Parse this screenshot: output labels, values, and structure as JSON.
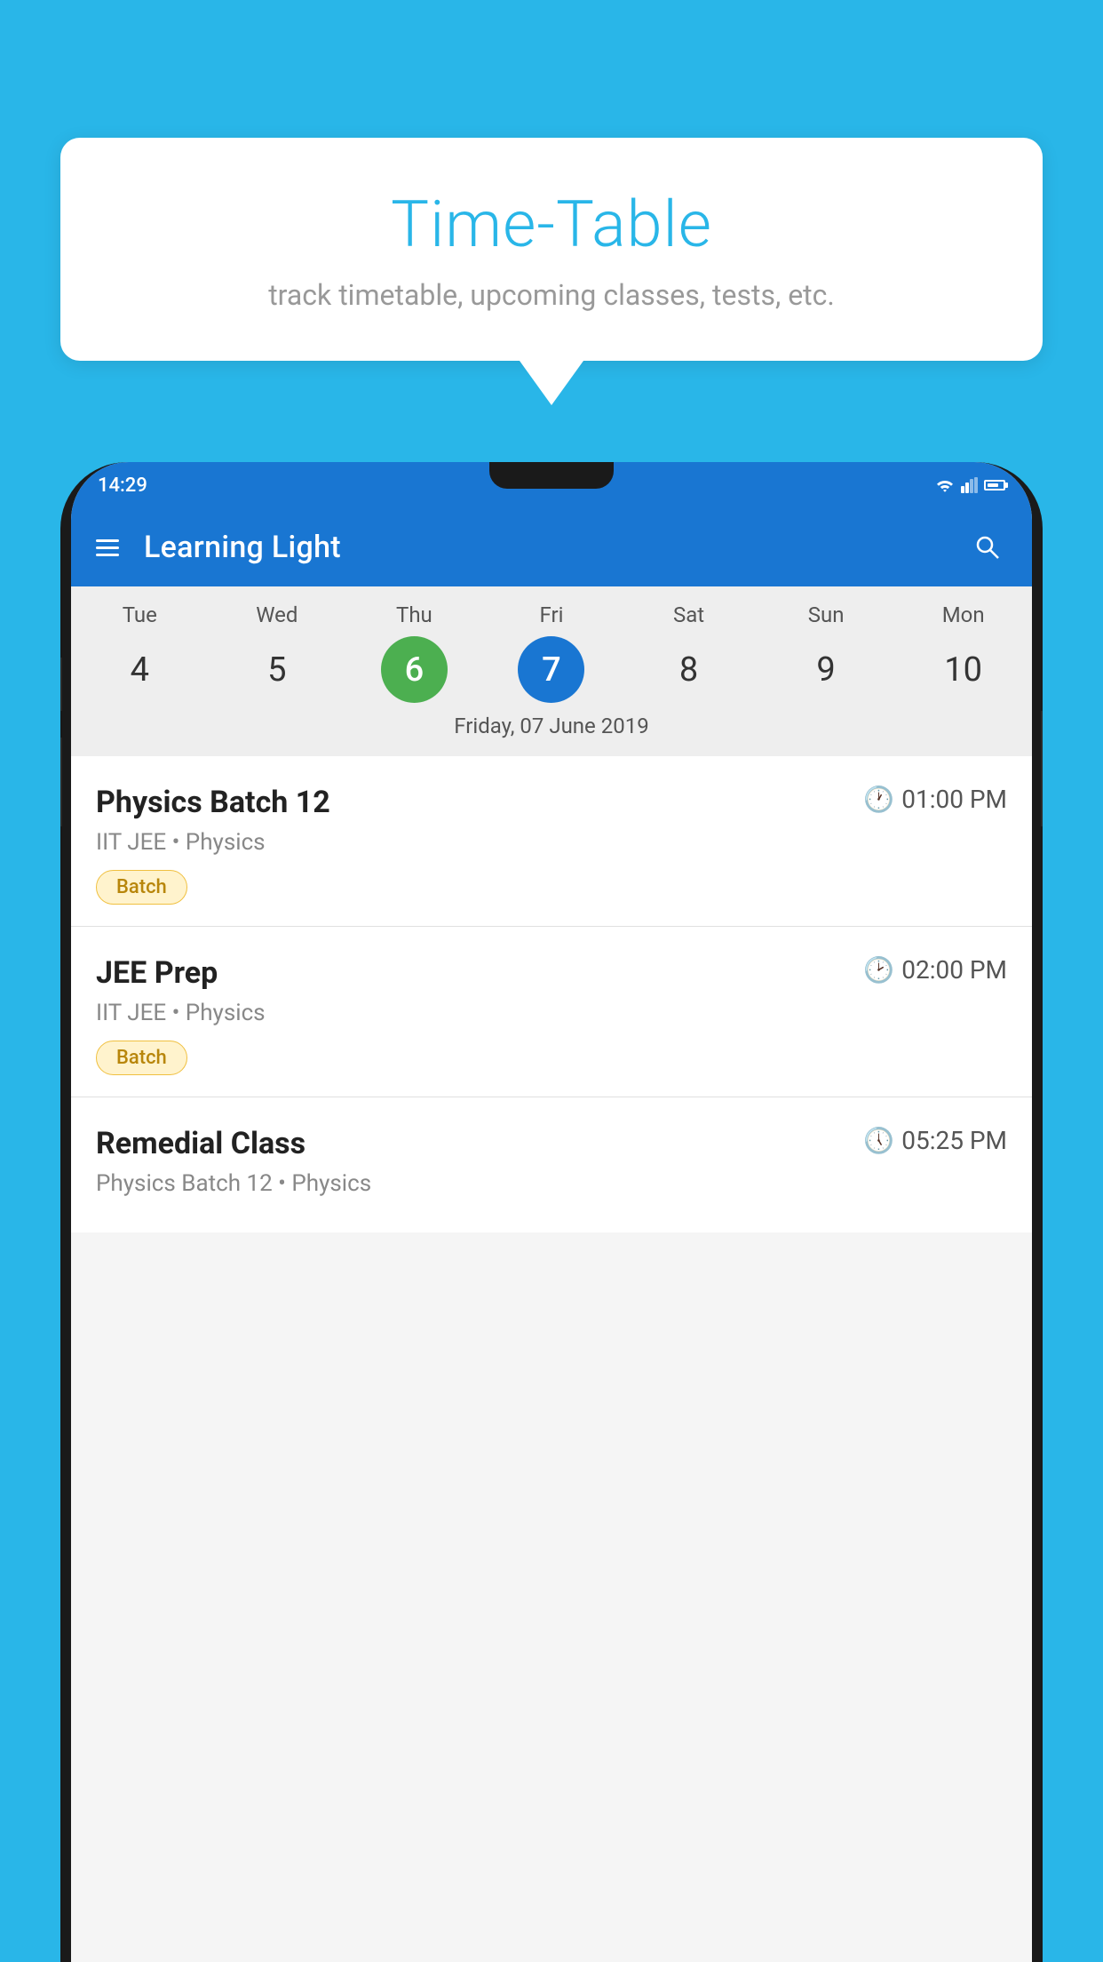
{
  "background_color": "#29b6e8",
  "speech_bubble": {
    "title": "Time-Table",
    "subtitle": "track timetable, upcoming classes, tests, etc."
  },
  "app_bar": {
    "title": "Learning Light",
    "hamburger_label": "menu",
    "search_label": "search"
  },
  "status_bar": {
    "time": "14:29"
  },
  "calendar": {
    "selected_date_label": "Friday, 07 June 2019",
    "days": [
      {
        "label": "Tue",
        "number": "4",
        "state": "normal"
      },
      {
        "label": "Wed",
        "number": "5",
        "state": "normal"
      },
      {
        "label": "Thu",
        "number": "6",
        "state": "today"
      },
      {
        "label": "Fri",
        "number": "7",
        "state": "selected"
      },
      {
        "label": "Sat",
        "number": "8",
        "state": "normal"
      },
      {
        "label": "Sun",
        "number": "9",
        "state": "normal"
      },
      {
        "label": "Mon",
        "number": "10",
        "state": "normal"
      }
    ]
  },
  "schedule": [
    {
      "title": "Physics Batch 12",
      "time": "01:00 PM",
      "subtitle": "IIT JEE • Physics",
      "badge": "Batch"
    },
    {
      "title": "JEE Prep",
      "time": "02:00 PM",
      "subtitle": "IIT JEE • Physics",
      "badge": "Batch"
    },
    {
      "title": "Remedial Class",
      "time": "05:25 PM",
      "subtitle": "Physics Batch 12 • Physics",
      "badge": null
    }
  ]
}
